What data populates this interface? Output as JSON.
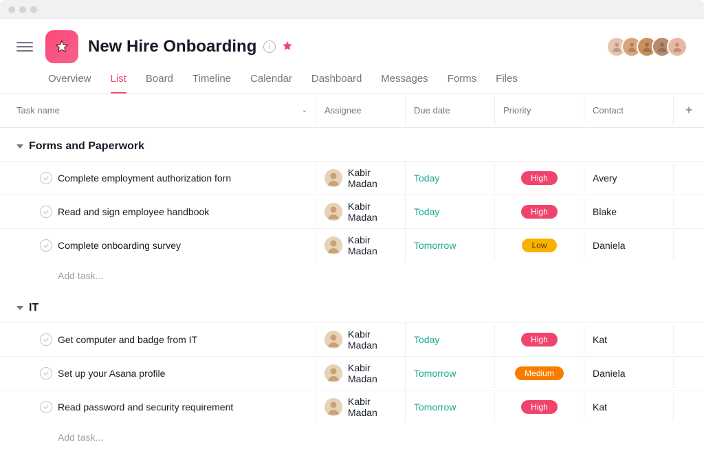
{
  "project": {
    "title": "New Hire Onboarding"
  },
  "tabs": [
    "Overview",
    "List",
    "Board",
    "Timeline",
    "Calendar",
    "Dashboard",
    "Messages",
    "Forms",
    "Files"
  ],
  "activeTab": "List",
  "columns": {
    "task": "Task name",
    "assignee": "Assignee",
    "due": "Due date",
    "priority": "Priority",
    "contact": "Contact"
  },
  "addTaskLabel": "Add task...",
  "avatars": [
    {
      "bg": "#e8c5b0"
    },
    {
      "bg": "#d9a57a"
    },
    {
      "bg": "#c98f5e"
    },
    {
      "bg": "#b98a6f"
    },
    {
      "bg": "#e8b9a0"
    }
  ],
  "sections": [
    {
      "name": "Forms and Paperwork",
      "tasks": [
        {
          "name": "Complete employment authorization forn",
          "assignee": "Kabir Madan",
          "due": "Today",
          "priority": "High",
          "contact": "Avery"
        },
        {
          "name": "Read and sign employee handbook",
          "assignee": "Kabir Madan",
          "due": "Today",
          "priority": "High",
          "contact": "Blake"
        },
        {
          "name": "Complete onboarding survey",
          "assignee": "Kabir Madan",
          "due": "Tomorrow",
          "priority": "Low",
          "contact": "Daniela"
        }
      ]
    },
    {
      "name": "IT",
      "tasks": [
        {
          "name": "Get computer and badge from IT",
          "assignee": "Kabir Madan",
          "due": "Today",
          "priority": "High",
          "contact": "Kat"
        },
        {
          "name": "Set up your Asana profile",
          "assignee": "Kabir Madan",
          "due": "Tomorrow",
          "priority": "Medium",
          "contact": "Daniela"
        },
        {
          "name": "Read password and security requirement",
          "assignee": "Kabir Madan",
          "due": "Tomorrow",
          "priority": "High",
          "contact": "Kat"
        }
      ]
    }
  ]
}
